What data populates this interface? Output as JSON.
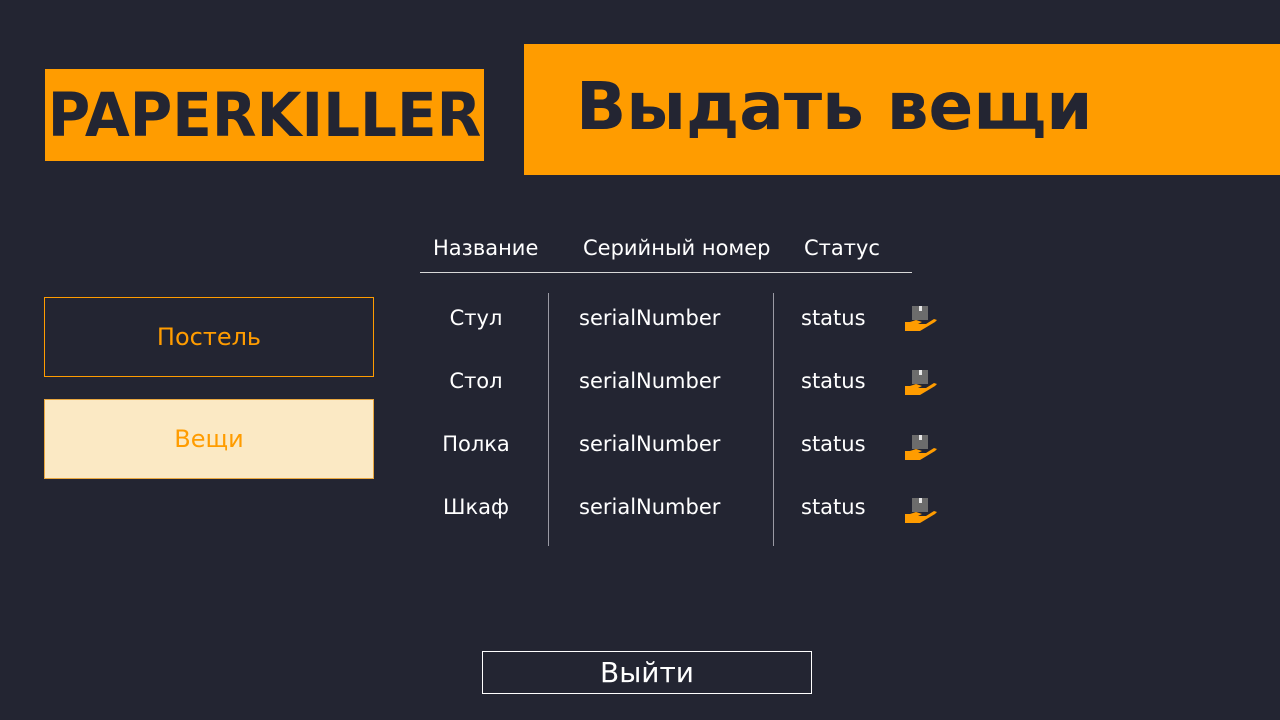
{
  "app": {
    "logo": "PAPERKILLER"
  },
  "header": {
    "title": "Выдать вещи"
  },
  "sidebar": {
    "items": [
      {
        "label": "Постель",
        "active": false
      },
      {
        "label": "Вещи",
        "active": true
      }
    ]
  },
  "table": {
    "columns": [
      "Название",
      "Серийный номер",
      "Статус"
    ],
    "rows": [
      {
        "name": "Стул",
        "serial": "serialNumber",
        "status": "status",
        "action_icon": "hand-box-icon"
      },
      {
        "name": "Стол",
        "serial": "serialNumber",
        "status": "status",
        "action_icon": "hand-box-icon"
      },
      {
        "name": "Полка",
        "serial": "serialNumber",
        "status": "status",
        "action_icon": "hand-box-icon"
      },
      {
        "name": "Шкаф",
        "serial": "serialNumber",
        "status": "status",
        "action_icon": "hand-box-icon"
      }
    ]
  },
  "footer": {
    "exit_label": "Выйти"
  },
  "colors": {
    "background": "#232532",
    "accent": "#ff9c00",
    "active_item_bg": "#fbe9c4"
  }
}
